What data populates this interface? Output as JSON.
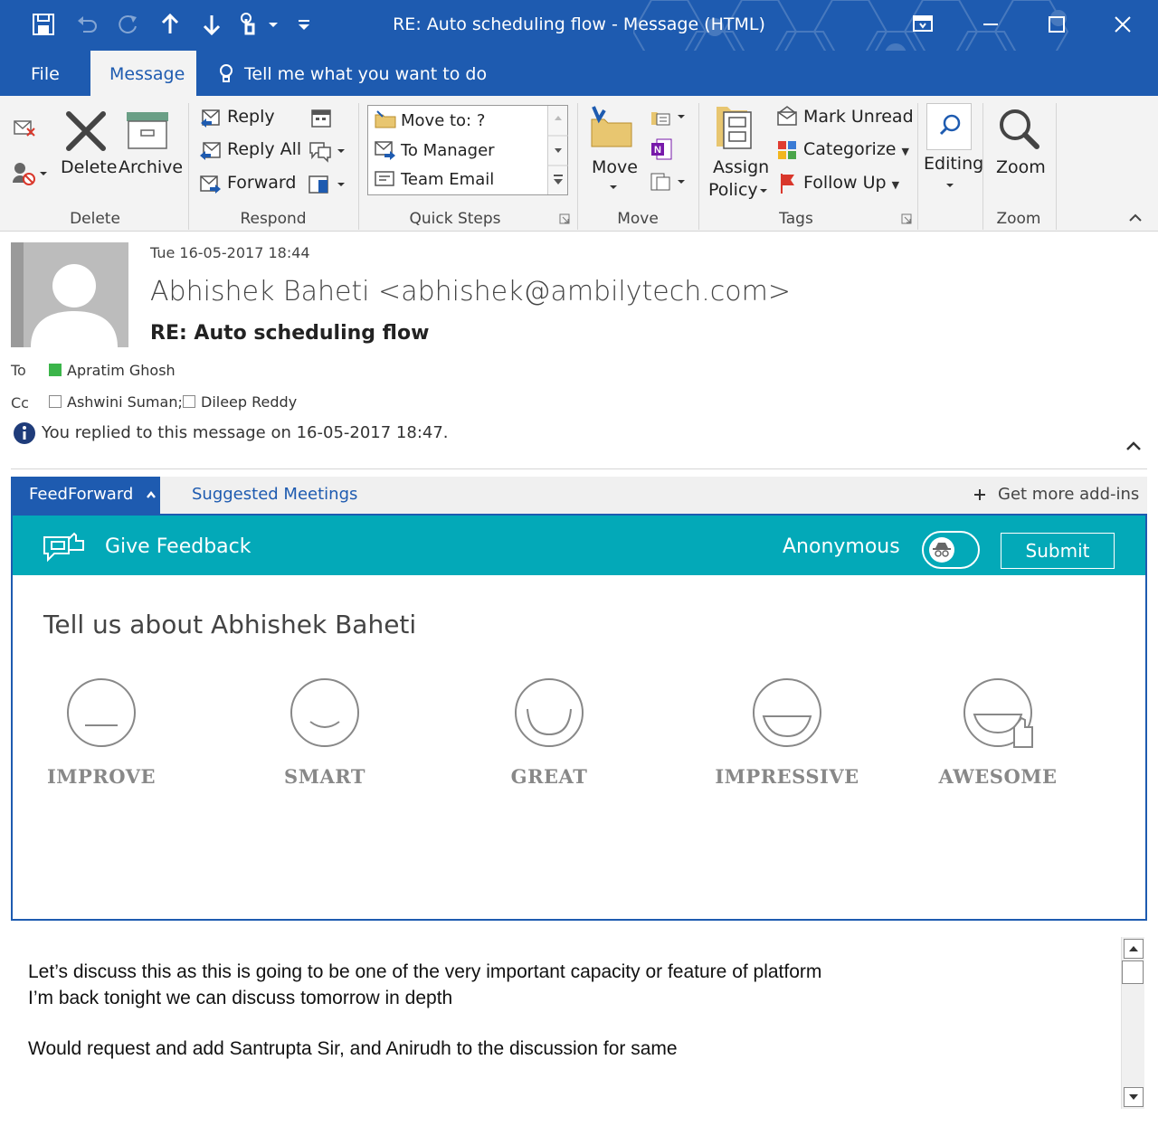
{
  "window": {
    "title": "RE: Auto scheduling flow  -  Message (HTML)"
  },
  "tabs": [
    {
      "label": "File"
    },
    {
      "label": "Message"
    }
  ],
  "tell_me": "Tell me what you want to do",
  "ribbon": {
    "delete_group": {
      "label": "Delete",
      "delete": "Delete",
      "archive": "Archive"
    },
    "respond_group": {
      "label": "Respond",
      "reply": "Reply",
      "reply_all": "Reply All",
      "forward": "Forward"
    },
    "quick_steps_group": {
      "label": "Quick Steps",
      "items": [
        "Move to: ?",
        "To Manager",
        "Team Email"
      ]
    },
    "move_group": {
      "label": "Move",
      "move": "Move"
    },
    "tags_group": {
      "label": "Tags",
      "assign_line1": "Assign",
      "assign_line2": "Policy",
      "mark_unread": "Mark Unread",
      "categorize": "Categorize",
      "follow_up": "Follow Up"
    },
    "editing_label": "Editing",
    "zoom_group": {
      "label": "Zoom",
      "zoom": "Zoom"
    }
  },
  "message": {
    "date": "Tue 16-05-2017 18:44",
    "from": "Abhishek Baheti <abhishek@ambilytech.com>",
    "subject": "RE: Auto scheduling flow",
    "to_label": "To",
    "to": "Apratim Ghosh",
    "cc_label": "Cc",
    "cc": [
      "Ashwini Suman;",
      "Dileep Reddy"
    ],
    "info": "You replied to this message on 16-05-2017 18:47."
  },
  "addins": {
    "feedforward": "FeedForward",
    "suggested": "Suggested Meetings",
    "more": "Get more add-ins"
  },
  "feedback": {
    "title": "Give Feedback",
    "anonymous": "Anonymous",
    "submit": "Submit",
    "tell_us": "Tell us about Abhishek Baheti",
    "ratings": [
      {
        "label": "IMPROVE"
      },
      {
        "label": "SMART"
      },
      {
        "label": "GREAT"
      },
      {
        "label": "IMPRESSIVE"
      },
      {
        "label": "AWESOME"
      }
    ]
  },
  "body": {
    "line1": "Let’s discuss this as this is going to be one of the very important capacity or feature of platform",
    "line2": "I’m back tonight we can discuss tomorrow in depth",
    "line3": "Would request and add Santrupta Sir, and Anirudh to the discussion for same"
  },
  "colors": {
    "brand_blue": "#1e5bb0",
    "teal": "#03a9b8"
  }
}
